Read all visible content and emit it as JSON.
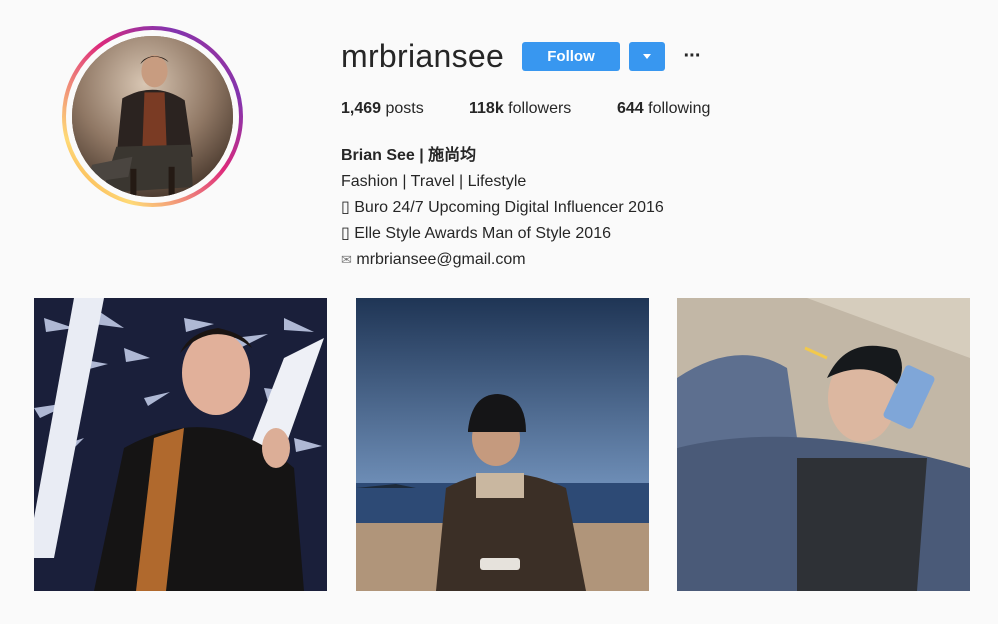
{
  "profile": {
    "username": "mrbriansee",
    "follow_label": "Follow",
    "more_label": "···"
  },
  "stats": {
    "posts_count": "1,469",
    "posts_label": " posts",
    "followers_count": "118k",
    "followers_label": " followers",
    "following_count": "644",
    "following_label": " following"
  },
  "bio": {
    "name": "Brian See | 施尚均",
    "line1": "Fashion | Travel | Lifestyle",
    "line2": "▯ Buro 24/7 Upcoming Digital Influencer 2016",
    "line3": "▯ Elle Style Awards Man of Style 2016",
    "email_icon": "✉",
    "email": "mrbriansee@gmail.com"
  },
  "posts": [
    {
      "icon": "photo-man-bamboo"
    },
    {
      "icon": "photo-man-beach"
    },
    {
      "icon": "photo-man-phone"
    }
  ],
  "colors": {
    "accent": "#3897f0",
    "text": "#262626",
    "background": "#fafafa"
  }
}
